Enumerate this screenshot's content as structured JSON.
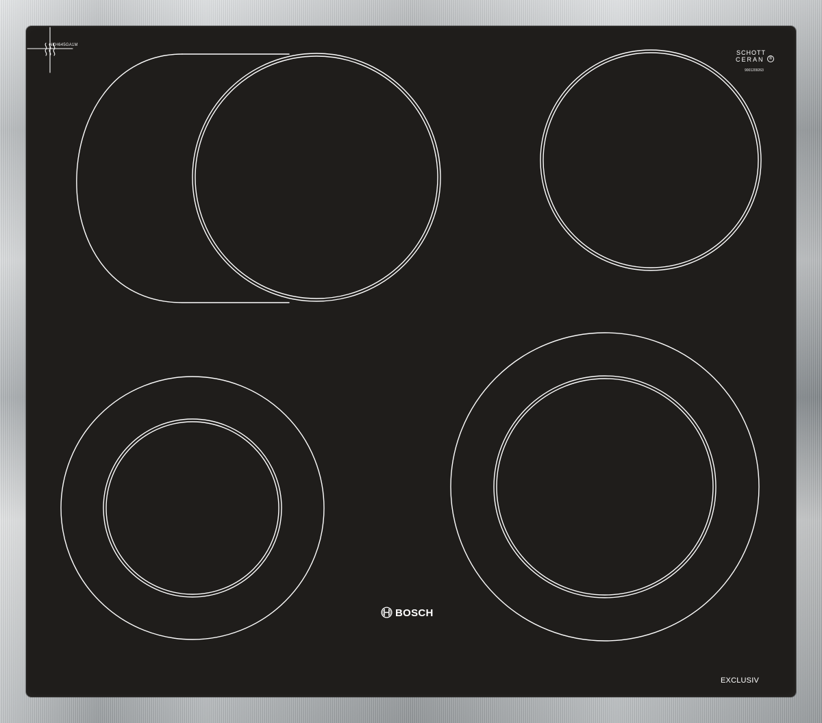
{
  "product": {
    "model_code": "NKH645GA1M",
    "glass_brand": {
      "line1": "SCHOTT",
      "line2": "CERAN",
      "registered": "®",
      "code": "9001209263"
    },
    "brand_name": "BOSCH",
    "series_label": "EXCLUSIV"
  },
  "icons": {
    "brand_mark": "bosch-armature-icon",
    "control_symbol": "heating-symbol-icon"
  },
  "colors": {
    "glass": "#1f1d1b",
    "outline": "#ffffff",
    "frame": "#9ea3a6"
  }
}
